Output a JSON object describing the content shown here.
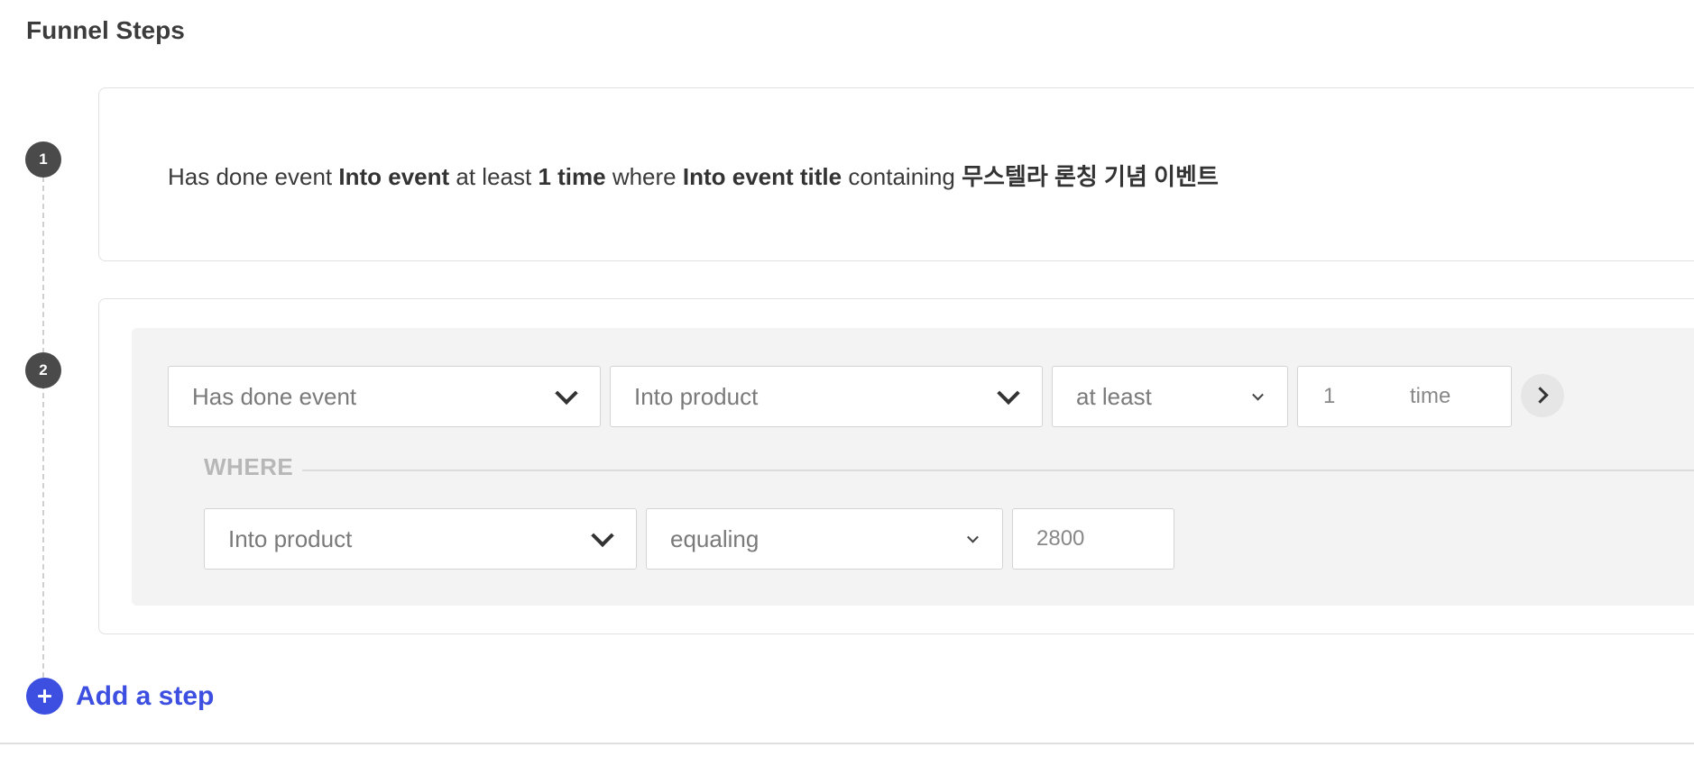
{
  "section_title": "Funnel Steps",
  "steps": [
    {
      "number": "1",
      "summary": {
        "p1": "Has done event ",
        "event": "Into event",
        "p2": " at least ",
        "count": "1 time",
        "p3": " where ",
        "property": "Into event title",
        "p4": " containing ",
        "value": "무스텔라 론칭 기념 이벤트"
      }
    },
    {
      "number": "2",
      "condition_type": "Has done event",
      "event": "Into product",
      "frequency_operator": "at least",
      "frequency_value": "1",
      "frequency_unit": "time",
      "where_label": "WHERE",
      "where": {
        "property": "Into product",
        "operator": "equaling",
        "value": "2800"
      }
    }
  ],
  "add_step_label": "Add a step",
  "icons": {
    "add": "plus-circle-icon",
    "next": "chevron-right-icon",
    "dropdown": "chevron-down-icon"
  },
  "colors": {
    "accent": "#3d4fe0",
    "badge": "#4a4a4a",
    "panel": "#f3f3f3"
  }
}
